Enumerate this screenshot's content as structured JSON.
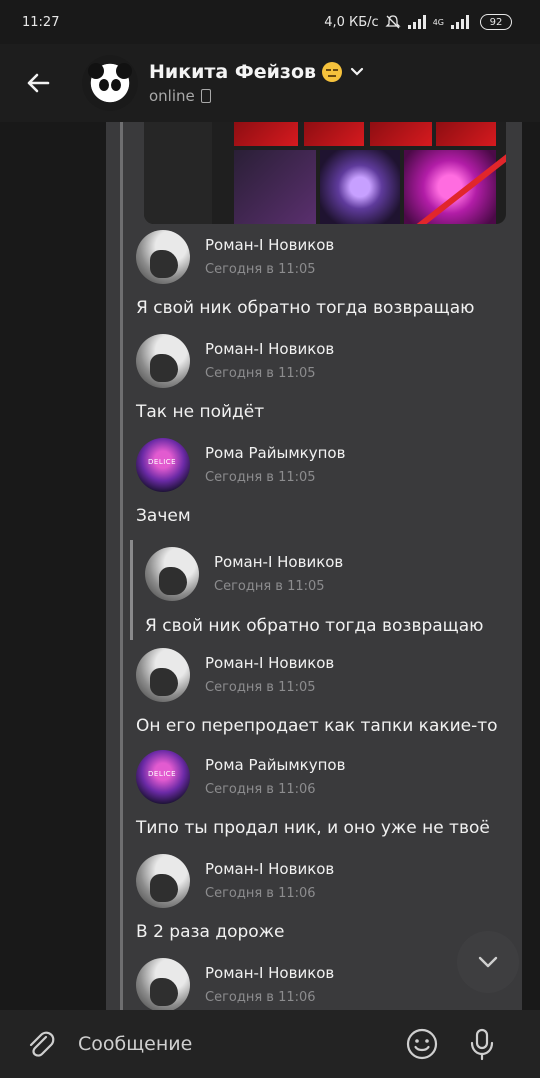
{
  "status_bar": {
    "time": "11:27",
    "speed": "4,0 КБ/с",
    "network": "4G",
    "battery": "92",
    "icons": [
      "mute-icon",
      "signal-icon",
      "signal-4g-icon",
      "battery-icon"
    ]
  },
  "header": {
    "contact_name": "Никита Фейзов",
    "status": "online",
    "icons": {
      "back": "back-arrow-icon",
      "emoji": "expressionless-emoji",
      "chevron": "chevron-down-icon",
      "device": "phone-icon"
    }
  },
  "messages": [
    {
      "author": "Роман-I Новиков",
      "time": "Сегодня в 11:05",
      "text": "Я свой ник обратно тогда возвращаю"
    },
    {
      "author": "Роман-I Новиков",
      "time": "Сегодня в 11:05",
      "text": "Так не пойдёт"
    },
    {
      "author": "Рома Райымкупов",
      "time": "Сегодня в 11:05",
      "text": "Зачем"
    },
    {
      "author": "Роман-I Новиков",
      "time": "Сегодня в 11:05",
      "text": "Я свой ник обратно тогда возвращаю"
    },
    {
      "author": "Роман-I Новиков",
      "time": "Сегодня в 11:05",
      "text": "Он его перепродает как тапки какие-то"
    },
    {
      "author": "Рома Райымкупов",
      "time": "Сегодня в 11:06",
      "text": "Типо ты продал ник, и оно уже не твоё"
    },
    {
      "author": "Роман-I Новиков",
      "time": "Сегодня в 11:06",
      "text": "В 2 раза дороже"
    },
    {
      "author": "Роман-I Новиков",
      "time": "Сегодня в 11:06",
      "text": ""
    }
  ],
  "composer": {
    "placeholder": "Сообщение",
    "icons": {
      "attach": "paperclip-icon",
      "emoji": "smile-icon",
      "mic": "microphone-icon"
    }
  },
  "scroll_button": {
    "icon": "chevron-down-icon"
  }
}
